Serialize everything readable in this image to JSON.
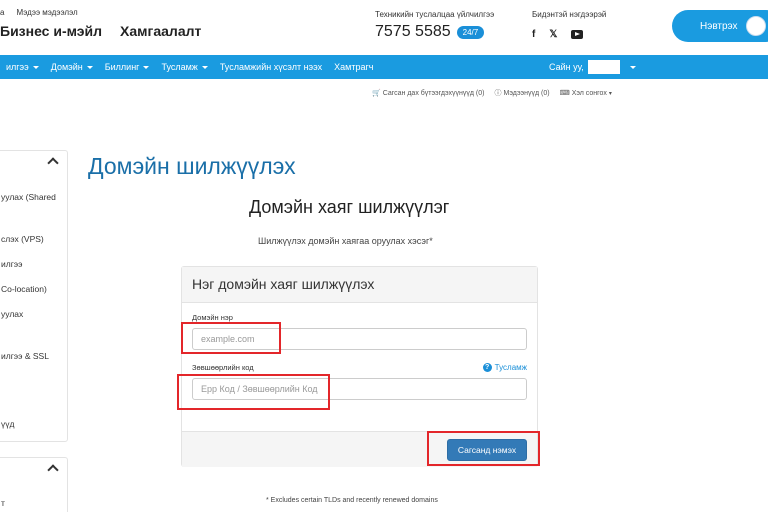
{
  "header": {
    "top_links": [
      "а",
      "Мэдээ мэдээлэл"
    ],
    "brand_links": [
      "Бизнес и-мэйл",
      "Хамгаалалт"
    ],
    "support_label": "Техникийн туслалцаа үйлчилгээ",
    "support_phone": "7575 5585",
    "support_badge": "24/7",
    "social_label": "Бидэнтэй нэгдээрэй",
    "social_icons": [
      "facebook-icon",
      "twitter-icon",
      "youtube-icon"
    ],
    "login_label": "Нэвтрэх"
  },
  "nav": {
    "items": [
      "илгээ",
      "Домэйн",
      "Биллинг",
      "Тусламж",
      "Тусламжийн хүсэлт нээх",
      "Хамтрагч"
    ],
    "greeting": "Сайн уу,"
  },
  "sublinks": {
    "cart": "Сагсан дах бүтээгдэхүүнүүд (0)",
    "notifications": "Мэдээнүүд (0)",
    "language": "Хэл сонгох"
  },
  "sidebar": {
    "items": [
      "уулах (Shared",
      "слэх (VPS)",
      "илгээ",
      "Co-location)",
      "уулах",
      "илгээ & SSL",
      "үүд"
    ],
    "second_item": "т"
  },
  "main": {
    "page_title": "Домэйн шилжүүлэх",
    "section_title": "Домэйн хаяг шилжүүлэг",
    "section_subtitle": "Шилжүүлэх домэйн хаягаа оруулах хэсэг*",
    "panel": {
      "title": "Нэг домэйн хаяг шилжүүлэх",
      "domain_label": "Домэйн нэр",
      "domain_placeholder": "example.com",
      "code_label": "Зөвшөөрлийн код",
      "code_placeholder": "Epp Код / Зөвшөөрлийн Код",
      "help_label": "Тусламж",
      "submit_label": "Сагсанд нэмэх"
    },
    "footnote": "* Excludes certain TLDs and recently renewed domains"
  },
  "colors": {
    "accent": "#1a9be0",
    "title": "#1a6fa8",
    "button": "#337ab7",
    "highlight": "#e3262a"
  }
}
